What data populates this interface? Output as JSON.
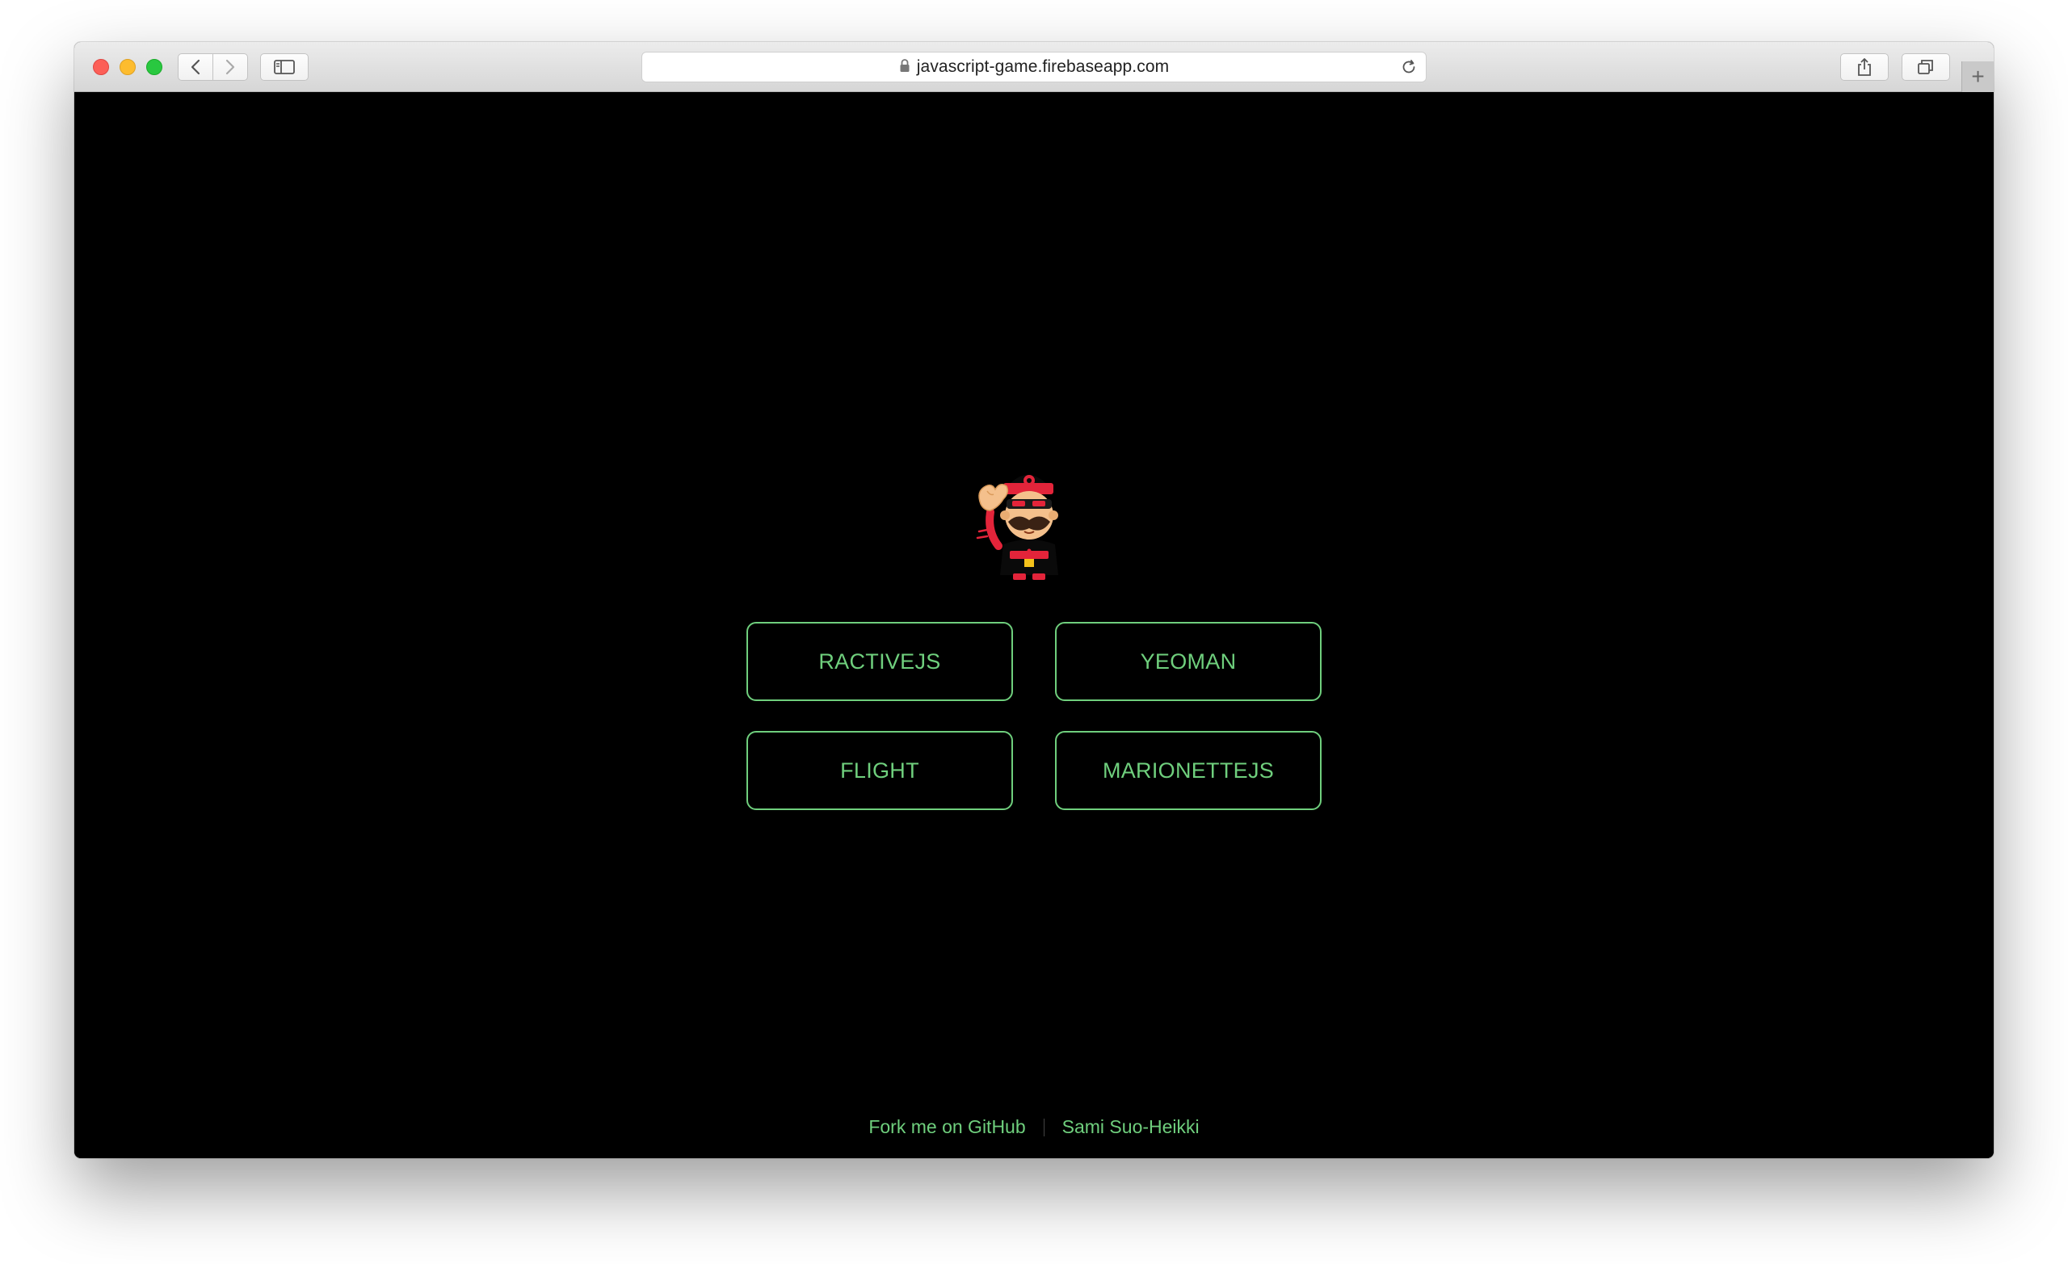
{
  "browser": {
    "url": "javascript-game.firebaseapp.com",
    "icons": {
      "back": "chevron-left-icon",
      "forward": "chevron-right-icon",
      "sidebar": "sidebar-icon",
      "lock": "lock-icon",
      "reload": "reload-icon",
      "share": "share-icon",
      "tabs": "tabs-icon",
      "new_tab": "plus-icon"
    },
    "new_tab_label": "+"
  },
  "page": {
    "mascot": "yeoman-mascot-icon",
    "buttons": [
      {
        "label": "RACTIVEJS"
      },
      {
        "label": "YEOMAN"
      },
      {
        "label": "FLIGHT"
      },
      {
        "label": "MARIONETTEJS"
      }
    ],
    "footer": {
      "fork_link": "Fork me on GitHub",
      "author_link": "Sami Suo-Heikki"
    }
  },
  "colors": {
    "background": "#000000",
    "accent": "#6fcf7d"
  }
}
